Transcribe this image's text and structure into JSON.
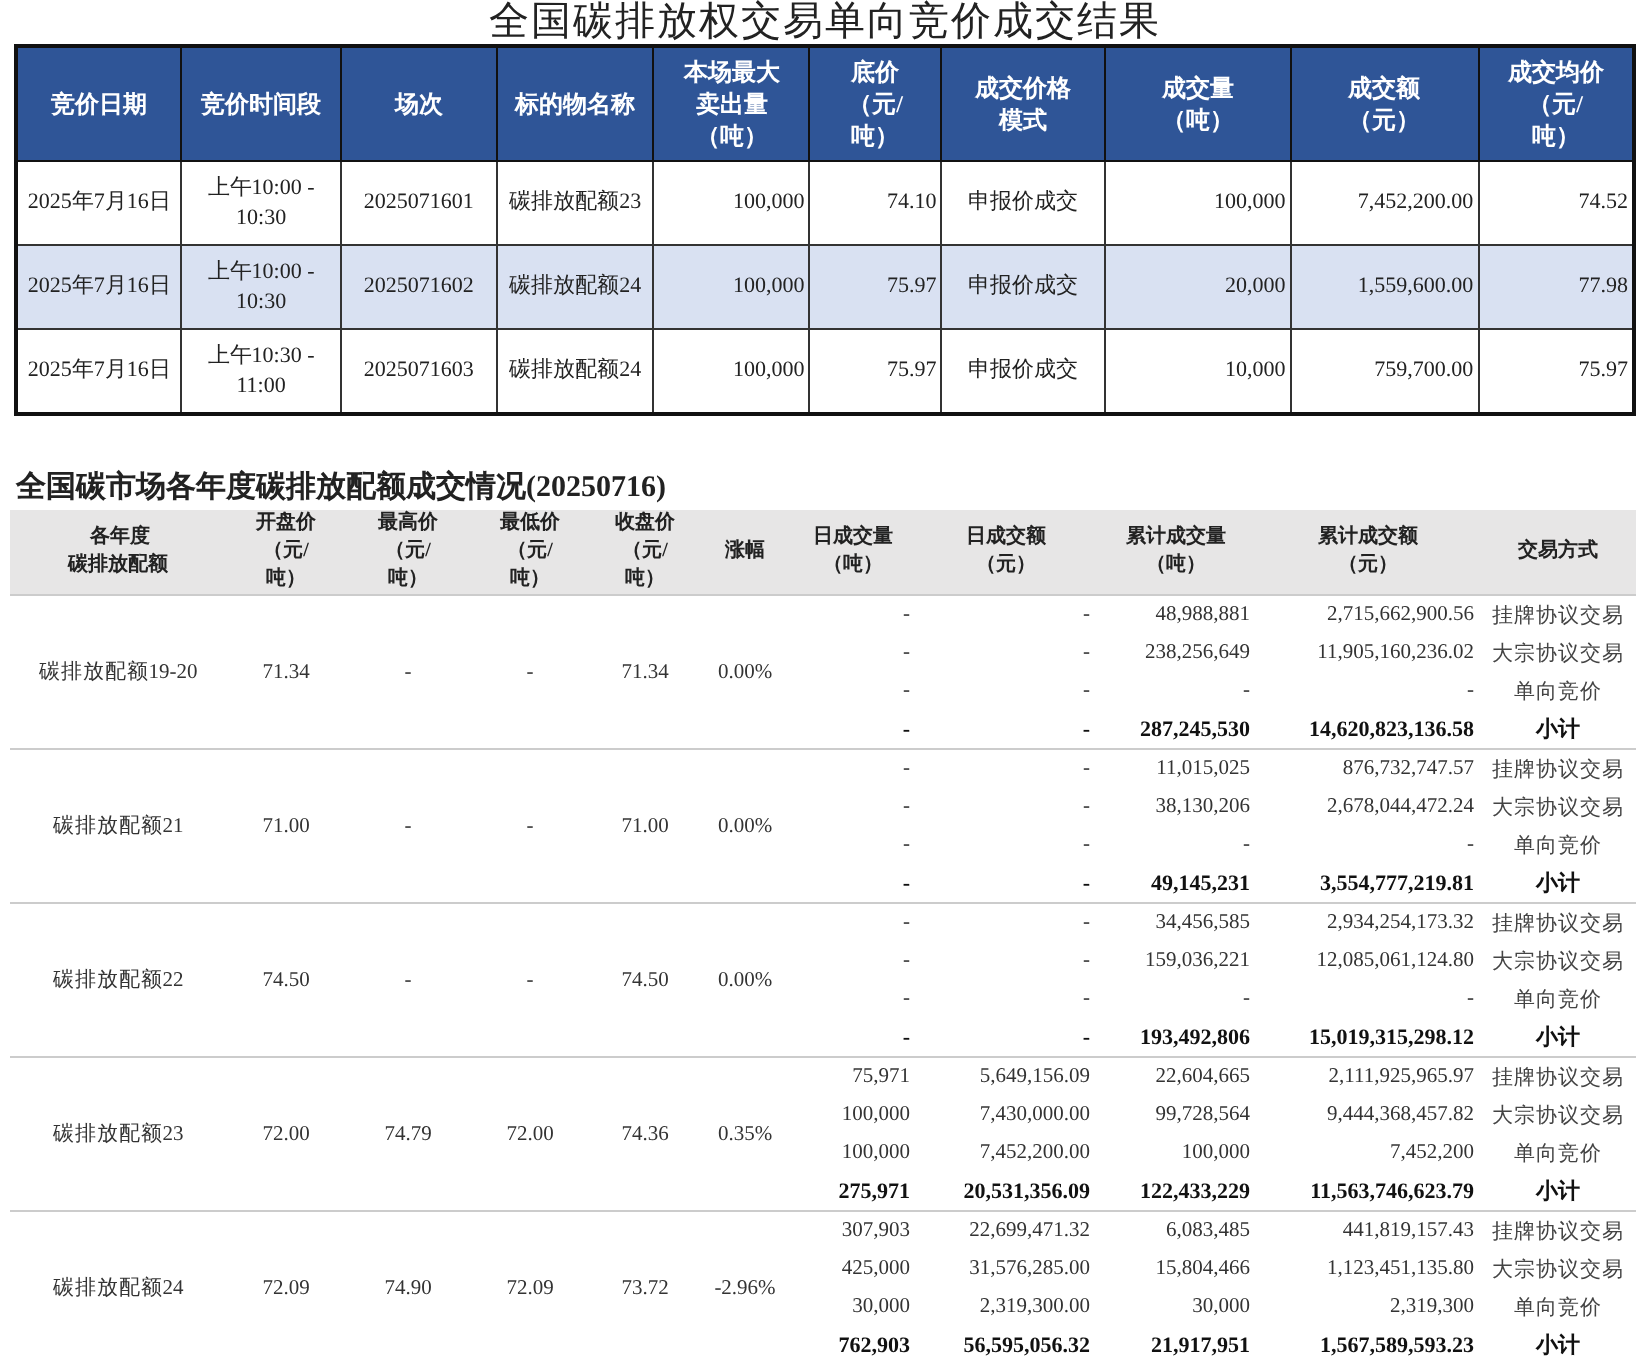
{
  "title": "全国碳排放权交易单向竞价成交结果",
  "auction_table": {
    "columns": [
      "竞价日期",
      "竞价时间段",
      "场次",
      "标的物名称",
      "本场最大卖出量（吨）",
      "底价（元/吨）",
      "成交价格模式",
      "成交量（吨）",
      "成交额（元）",
      "成交均价（元/吨）"
    ],
    "rows": [
      {
        "cells": [
          "2025年7月16日",
          "上午10:00 -\n10:30",
          "2025071601",
          "碳排放配额23",
          "100,000",
          "74.10",
          "申报价成交",
          "100,000",
          "7,452,200.00",
          "74.52"
        ]
      },
      {
        "cells": [
          "2025年7月16日",
          "上午10:00 -\n10:30",
          "2025071602",
          "碳排放配额24",
          "100,000",
          "75.97",
          "申报价成交",
          "20,000",
          "1,559,600.00",
          "77.98"
        ]
      },
      {
        "cells": [
          "2025年7月16日",
          "上午10:30 -\n11:00",
          "2025071603",
          "碳排放配额24",
          "100,000",
          "75.97",
          "申报价成交",
          "10,000",
          "759,700.00",
          "75.97"
        ]
      }
    ]
  },
  "market_section": {
    "title": "全国碳市场各年度碳排放配额成交情况(20250716)",
    "columns": [
      "各年度碳排放配额",
      "开盘价（元/吨）",
      "最高价（元/吨）",
      "最低价（元/吨）",
      "收盘价（元/吨）",
      "涨幅",
      "日成交量（吨）",
      "日成交额（元）",
      "累计成交量（吨）",
      "累计成交额（元）",
      "交易方式"
    ],
    "groups": [
      {
        "name": "碳排放配额19-20",
        "open": "71.34",
        "high": "-",
        "low": "-",
        "close": "71.34",
        "change": "0.00%",
        "rows": [
          {
            "kind": "trade",
            "daily_volume": "-",
            "daily_amount": "-",
            "cum_volume": "48,988,881",
            "cum_amount": "2,715,662,900.56",
            "method": "挂牌协议交易"
          },
          {
            "kind": "trade",
            "daily_volume": "-",
            "daily_amount": "-",
            "cum_volume": "238,256,649",
            "cum_amount": "11,905,160,236.02",
            "method": "大宗协议交易"
          },
          {
            "kind": "trade",
            "daily_volume": "-",
            "daily_amount": "-",
            "cum_volume": "-",
            "cum_amount": "-",
            "method": "单向竞价"
          },
          {
            "kind": "subtotal",
            "daily_volume": "-",
            "daily_amount": "-",
            "cum_volume": "287,245,530",
            "cum_amount": "14,620,823,136.58",
            "method": "小计"
          }
        ]
      },
      {
        "name": "碳排放配额21",
        "open": "71.00",
        "high": "-",
        "low": "-",
        "close": "71.00",
        "change": "0.00%",
        "rows": [
          {
            "kind": "trade",
            "daily_volume": "-",
            "daily_amount": "-",
            "cum_volume": "11,015,025",
            "cum_amount": "876,732,747.57",
            "method": "挂牌协议交易"
          },
          {
            "kind": "trade",
            "daily_volume": "-",
            "daily_amount": "-",
            "cum_volume": "38,130,206",
            "cum_amount": "2,678,044,472.24",
            "method": "大宗协议交易"
          },
          {
            "kind": "trade",
            "daily_volume": "-",
            "daily_amount": "-",
            "cum_volume": "-",
            "cum_amount": "-",
            "method": "单向竞价"
          },
          {
            "kind": "subtotal",
            "daily_volume": "-",
            "daily_amount": "-",
            "cum_volume": "49,145,231",
            "cum_amount": "3,554,777,219.81",
            "method": "小计"
          }
        ]
      },
      {
        "name": "碳排放配额22",
        "open": "74.50",
        "high": "-",
        "low": "-",
        "close": "74.50",
        "change": "0.00%",
        "rows": [
          {
            "kind": "trade",
            "daily_volume": "-",
            "daily_amount": "-",
            "cum_volume": "34,456,585",
            "cum_amount": "2,934,254,173.32",
            "method": "挂牌协议交易"
          },
          {
            "kind": "trade",
            "daily_volume": "-",
            "daily_amount": "-",
            "cum_volume": "159,036,221",
            "cum_amount": "12,085,061,124.80",
            "method": "大宗协议交易"
          },
          {
            "kind": "trade",
            "daily_volume": "-",
            "daily_amount": "-",
            "cum_volume": "-",
            "cum_amount": "-",
            "method": "单向竞价"
          },
          {
            "kind": "subtotal",
            "daily_volume": "-",
            "daily_amount": "-",
            "cum_volume": "193,492,806",
            "cum_amount": "15,019,315,298.12",
            "method": "小计"
          }
        ]
      },
      {
        "name": "碳排放配额23",
        "open": "72.00",
        "high": "74.79",
        "low": "72.00",
        "close": "74.36",
        "change": "0.35%",
        "rows": [
          {
            "kind": "trade",
            "daily_volume": "75,971",
            "daily_amount": "5,649,156.09",
            "cum_volume": "22,604,665",
            "cum_amount": "2,111,925,965.97",
            "method": "挂牌协议交易"
          },
          {
            "kind": "trade",
            "daily_volume": "100,000",
            "daily_amount": "7,430,000.00",
            "cum_volume": "99,728,564",
            "cum_amount": "9,444,368,457.82",
            "method": "大宗协议交易"
          },
          {
            "kind": "trade",
            "daily_volume": "100,000",
            "daily_amount": "7,452,200.00",
            "cum_volume": "100,000",
            "cum_amount": "7,452,200",
            "method": "单向竞价"
          },
          {
            "kind": "subtotal",
            "daily_volume": "275,971",
            "daily_amount": "20,531,356.09",
            "cum_volume": "122,433,229",
            "cum_amount": "11,563,746,623.79",
            "method": "小计"
          }
        ]
      },
      {
        "name": "碳排放配额24",
        "open": "72.09",
        "high": "74.90",
        "low": "72.09",
        "close": "73.72",
        "change": "-2.96%",
        "rows": [
          {
            "kind": "trade",
            "daily_volume": "307,903",
            "daily_amount": "22,699,471.32",
            "cum_volume": "6,083,485",
            "cum_amount": "441,819,157.43",
            "method": "挂牌协议交易"
          },
          {
            "kind": "trade",
            "daily_volume": "425,000",
            "daily_amount": "31,576,285.00",
            "cum_volume": "15,804,466",
            "cum_amount": "1,123,451,135.80",
            "method": "大宗协议交易"
          },
          {
            "kind": "trade",
            "daily_volume": "30,000",
            "daily_amount": "2,319,300.00",
            "cum_volume": "30,000",
            "cum_amount": "2,319,300",
            "method": "单向竞价"
          },
          {
            "kind": "subtotal",
            "daily_volume": "762,903",
            "daily_amount": "56,595,056.32",
            "cum_volume": "21,917,951",
            "cum_amount": "1,567,589,593.23",
            "method": "小计"
          }
        ]
      }
    ]
  }
}
